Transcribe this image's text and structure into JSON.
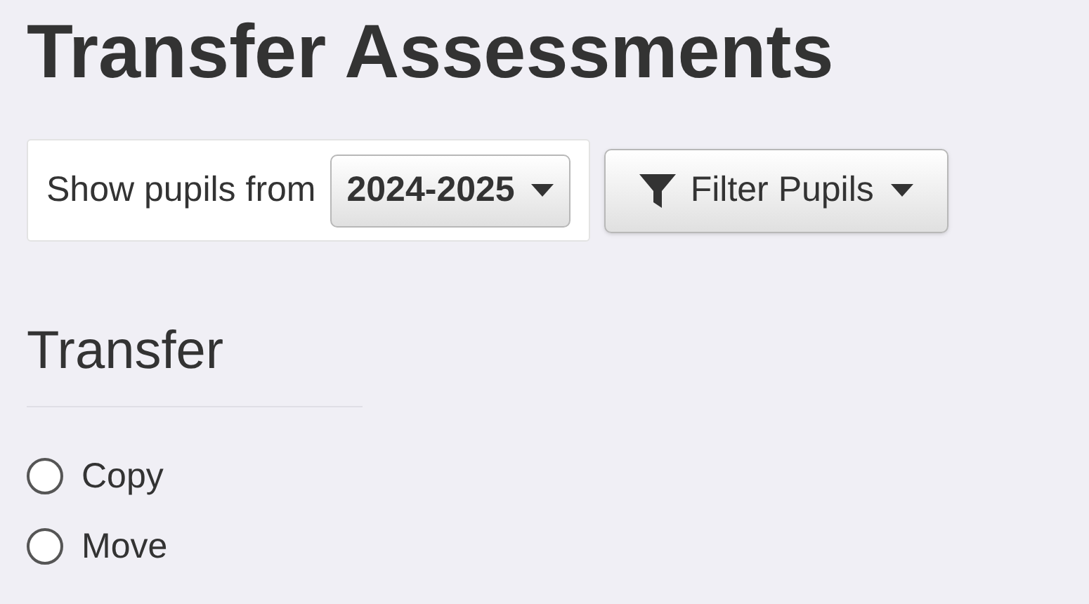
{
  "title": "Transfer Assessments",
  "year_filter": {
    "label": "Show pupils from",
    "value": "2024-2025"
  },
  "filter_button": {
    "label": "Filter Pupils"
  },
  "section": {
    "heading": "Transfer"
  },
  "options": [
    {
      "label": "Copy",
      "selected": false
    },
    {
      "label": "Move",
      "selected": false
    }
  ]
}
